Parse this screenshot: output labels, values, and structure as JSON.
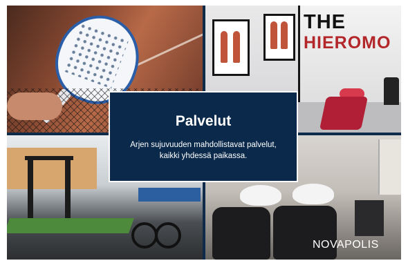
{
  "card": {
    "title": "Palvelut",
    "description_line1": "Arjen sujuvuuden mahdollistavat palvelut,",
    "description_line2": "kaikki yhdessä paikassa."
  },
  "massage_sign": {
    "line1": "THE",
    "line2": "HIEROMO"
  },
  "brand": "NOVAPOLIS",
  "colors": {
    "card_background": "#0b2a4b",
    "divider": "#0e2c4a"
  }
}
